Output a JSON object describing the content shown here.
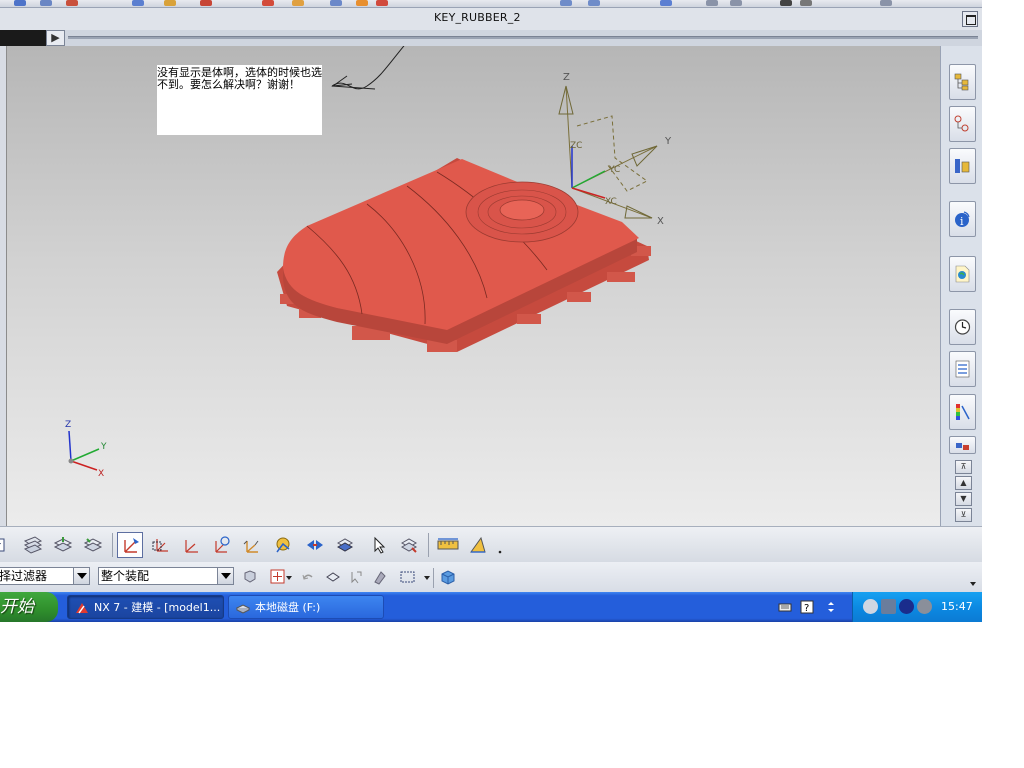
{
  "window": {
    "title": "KEY_RUBBER_2"
  },
  "nav": {
    "expand_glyph": "▶"
  },
  "note": {
    "text": "没有显示是体啊，选体的时候也选不到。要怎么解决啊？谢谢！"
  },
  "triad": {
    "z": "Z",
    "y": "Y",
    "x": "X",
    "zc": "ZC",
    "yc": "YC",
    "xc": "XC"
  },
  "mini_triad": {
    "z": "Z",
    "y": "Y",
    "x": "X"
  },
  "model": {
    "color": "#e0594c"
  },
  "filter_bar": {
    "selection_filter": "择过滤器",
    "assembly_scope": "整个装配"
  },
  "taskbar": {
    "start_label": "开始",
    "tasks": [
      {
        "label": "NX 7 - 建模 - [model1...",
        "icon": "nx-icon",
        "active": true
      },
      {
        "label": "本地磁盘 (F:)",
        "icon": "drive-icon",
        "active": false
      }
    ],
    "clock": "15:47"
  },
  "colors": {
    "taskbar": "#245edb",
    "start": "#3fa83e",
    "tray": "#0c8ae3",
    "accent_model": "#e0594c"
  }
}
